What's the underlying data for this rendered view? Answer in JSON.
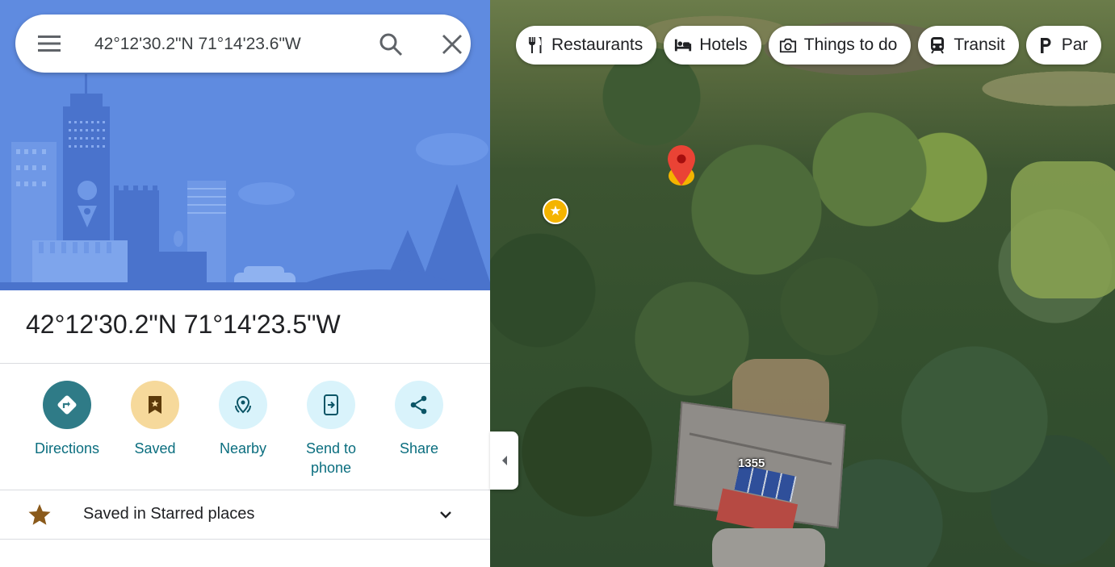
{
  "search": {
    "value": "42°12'30.2\"N 71°14'23.6\"W",
    "menu_icon": "menu-icon",
    "search_icon": "search-icon",
    "close_icon": "close-icon"
  },
  "place": {
    "title": "42°12'30.2\"N 71°14'23.5\"W"
  },
  "actions": [
    {
      "label": "Directions",
      "icon": "directions-icon",
      "bg": "#2f7b87",
      "fg": "#ffffff"
    },
    {
      "label": "Saved",
      "icon": "bookmark-icon",
      "bg": "#f6d99b",
      "fg": "#5c3a0a"
    },
    {
      "label": "Nearby",
      "icon": "nearby-icon",
      "bg": "#d9f3fb",
      "fg": "#0b5566"
    },
    {
      "label": "Send to phone",
      "icon": "send-to-phone-icon",
      "bg": "#d9f3fb",
      "fg": "#0b5566"
    },
    {
      "label": "Share",
      "icon": "share-icon",
      "bg": "#d9f3fb",
      "fg": "#0b5566"
    }
  ],
  "saved_list": {
    "label": "Saved in Starred places",
    "star_color": "#8a5a1b"
  },
  "map": {
    "chips": [
      {
        "label": "Restaurants",
        "icon": "fork-knife-icon"
      },
      {
        "label": "Hotels",
        "icon": "bed-icon"
      },
      {
        "label": "Things to do",
        "icon": "camera-icon"
      },
      {
        "label": "Transit",
        "icon": "train-icon"
      },
      {
        "label": "Par",
        "icon": "parking-icon"
      }
    ],
    "house_number": "1355",
    "pin_color": "#ea4335",
    "star_pin_color": "#f4b400"
  }
}
